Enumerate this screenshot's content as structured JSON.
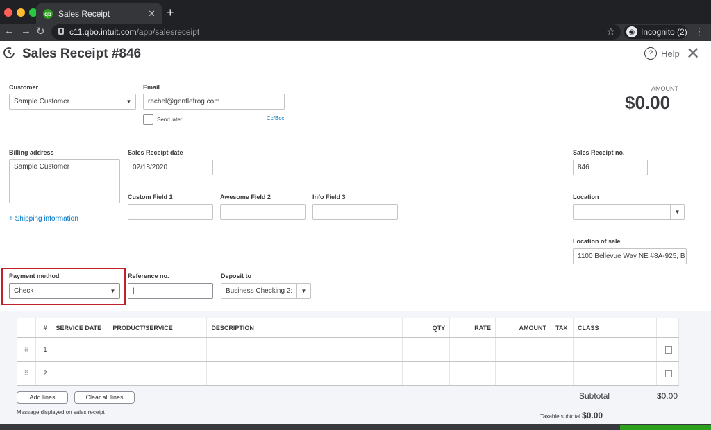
{
  "browser": {
    "tab_title": "Sales Receipt",
    "favicon_text": "qb",
    "url_host": "c11.qbo.intuit.com",
    "url_path": "/app/salesreceipt",
    "profile_label": "Incognito (2)"
  },
  "header": {
    "title": "Sales Receipt #846",
    "help_label": "Help"
  },
  "form": {
    "customer_label": "Customer",
    "customer_value": "Sample Customer",
    "email_label": "Email",
    "email_value": "rachel@gentlefrog.com",
    "send_later_label": "Send later",
    "cc_bcc_label": "Cc/Bcc",
    "amount_label": "AMOUNT",
    "amount_value": "$0.00",
    "billing_label": "Billing address",
    "billing_value": "Sample Customer",
    "shipping_link": "+ Shipping information",
    "date_label": "Sales Receipt date",
    "date_value": "02/18/2020",
    "receipt_no_label": "Sales Receipt no.",
    "receipt_no_value": "846",
    "custom1_label": "Custom Field 1",
    "custom2_label": "Awesome Field 2",
    "custom3_label": "Info Field 3",
    "location_label": "Location",
    "location_sale_label": "Location of sale",
    "location_sale_value": "1100 Bellevue Way NE #8A-925, B",
    "payment_label": "Payment method",
    "payment_value": "Check",
    "reference_label": "Reference no.",
    "reference_value": "|",
    "deposit_label": "Deposit to",
    "deposit_value": "Business Checking 2:"
  },
  "table": {
    "headers": [
      "#",
      "SERVICE DATE",
      "PRODUCT/SERVICE",
      "DESCRIPTION",
      "QTY",
      "RATE",
      "AMOUNT",
      "TAX",
      "CLASS"
    ],
    "rows": [
      {
        "num": "1"
      },
      {
        "num": "2"
      }
    ]
  },
  "actions": {
    "add_lines": "Add lines",
    "clear_lines": "Clear all lines"
  },
  "totals": {
    "subtotal_label": "Subtotal",
    "subtotal_value": "$0.00",
    "taxable_label": "Taxable subtotal",
    "taxable_value": "$0.00"
  },
  "message_label": "Message displayed on sales receipt",
  "colors": {
    "brand_green": "#2ca01c",
    "highlight_red": "#c0202a",
    "link_blue": "#0077c5"
  }
}
